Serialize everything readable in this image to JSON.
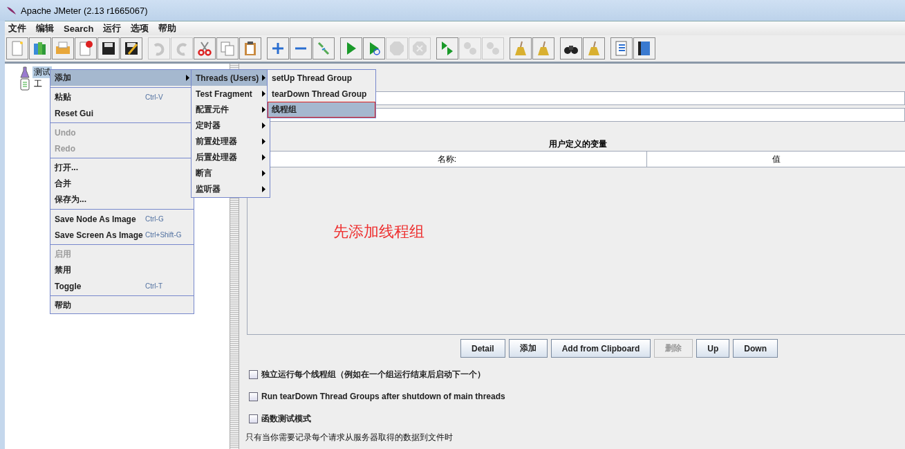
{
  "window": {
    "title": "Apache JMeter (2.13 r1665067)"
  },
  "menu_bar": [
    "文件",
    "编辑",
    "Search",
    "运行",
    "选项",
    "帮助"
  ],
  "toolbar": [
    [
      {
        "disabled": false
      },
      {
        "disabled": false
      },
      {
        "disabled": false
      },
      {
        "disabled": false
      },
      {
        "disabled": false
      },
      {
        "disabled": false
      }
    ],
    [
      {
        "disabled": true
      },
      {
        "disabled": true
      },
      {
        "disabled": false
      },
      {
        "disabled": false
      },
      {
        "disabled": false
      }
    ],
    [
      {
        "disabled": false
      },
      {
        "disabled": false
      },
      {
        "disabled": false
      }
    ],
    [
      {
        "disabled": false
      },
      {
        "disabled": false
      },
      {
        "disabled": true
      },
      {
        "disabled": true
      }
    ],
    [
      {
        "disabled": false
      },
      {
        "disabled": true
      },
      {
        "disabled": true
      }
    ],
    [
      {
        "disabled": false
      },
      {
        "disabled": false
      }
    ],
    [
      {
        "disabled": false
      },
      {
        "disabled": false
      }
    ],
    [
      {
        "disabled": false
      },
      {
        "disabled": false
      }
    ]
  ],
  "tree": [
    {
      "label": "测试",
      "selected": true
    },
    {
      "label": "工",
      "selected": false
    }
  ],
  "context_menu": [
    [
      {
        "label": "添加",
        "disabled": false,
        "selected": true,
        "submenu": true
      }
    ],
    [
      {
        "label": "粘贴",
        "shortcut": "Ctrl-V",
        "disabled": false,
        "selected": false,
        "submenu": false
      },
      {
        "label": "Reset Gui",
        "disabled": false,
        "selected": false,
        "submenu": false
      }
    ],
    [
      {
        "label": "Undo",
        "disabled": true,
        "selected": false,
        "submenu": false
      },
      {
        "label": "Redo",
        "disabled": true,
        "selected": false,
        "submenu": false
      }
    ],
    [
      {
        "label": "打开...",
        "disabled": false,
        "selected": false,
        "submenu": false
      },
      {
        "label": "合并",
        "disabled": false,
        "selected": false,
        "submenu": false
      },
      {
        "label": "保存为...",
        "disabled": false,
        "selected": false,
        "submenu": false
      }
    ],
    [
      {
        "label": "Save Node As Image",
        "shortcut": "Ctrl-G",
        "disabled": false,
        "selected": false,
        "submenu": false
      },
      {
        "label": "Save Screen As Image",
        "shortcut": "Ctrl+Shift-G",
        "disabled": false,
        "selected": false,
        "submenu": false
      }
    ],
    [
      {
        "label": "启用",
        "disabled": true,
        "selected": false,
        "submenu": false
      },
      {
        "label": "禁用",
        "disabled": false,
        "selected": false,
        "submenu": false
      },
      {
        "label": "Toggle",
        "shortcut": "Ctrl-T",
        "disabled": false,
        "selected": false,
        "submenu": false
      }
    ],
    [
      {
        "label": "帮助",
        "disabled": false,
        "selected": false,
        "submenu": false
      }
    ]
  ],
  "add_submenu": [
    {
      "label": "Threads (Users)",
      "selected": true,
      "submenu": true
    },
    {
      "label": "Test Fragment",
      "selected": false,
      "submenu": true
    },
    {
      "label": "配置元件",
      "selected": false,
      "submenu": true
    },
    {
      "label": "定时器",
      "selected": false,
      "submenu": true
    },
    {
      "label": "前置处理器",
      "selected": false,
      "submenu": true
    },
    {
      "label": "后置处理器",
      "selected": false,
      "submenu": true
    },
    {
      "label": "断言",
      "selected": false,
      "submenu": true
    },
    {
      "label": "监听器",
      "selected": false,
      "submenu": true
    }
  ],
  "threads_submenu": [
    {
      "label": "setUp Thread Group",
      "selected": false,
      "annotated": false
    },
    {
      "label": "tearDown Thread Group",
      "selected": false,
      "annotated": false
    },
    {
      "label": "线程组",
      "selected": true,
      "annotated": true
    }
  ],
  "variables_table": {
    "title": "用户定义的变量",
    "columns": [
      "名称:",
      "值"
    ]
  },
  "annotation": {
    "text": "先添加线程组"
  },
  "buttons": [
    {
      "label": "Detail",
      "disabled": false
    },
    {
      "label": "添加",
      "disabled": false
    },
    {
      "label": "Add from Clipboard",
      "disabled": false
    },
    {
      "label": "删除",
      "disabled": true
    },
    {
      "label": "Up",
      "disabled": false
    },
    {
      "label": "Down",
      "disabled": false
    }
  ],
  "options": [
    {
      "label": "独立运行每个线程组（例如在一个组运行结束后启动下一个）",
      "checked": false
    },
    {
      "label": "Run tearDown Thread Groups after shutdown of main threads",
      "checked": false
    },
    {
      "label": "函数测试模式",
      "checked": false
    }
  ],
  "footnote": "只有当你需要记录每个请求从服务器取得的数据到文件时"
}
